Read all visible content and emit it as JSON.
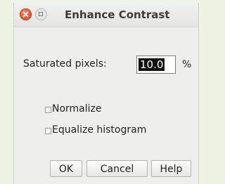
{
  "window": {
    "title": "Enhance Contrast"
  },
  "saturated": {
    "label": "Saturated pixels:",
    "value": "10.0",
    "unit": "%"
  },
  "options": [
    {
      "label": "Normalize",
      "checked": false
    },
    {
      "label": "Equalize histogram",
      "checked": false
    }
  ],
  "buttons": {
    "ok": "OK",
    "cancel": "Cancel",
    "help": "Help"
  },
  "icons": {
    "close": "close-icon",
    "maximize": "maximize-icon"
  },
  "colors": {
    "close_button": "#e2522a",
    "selection": "#111111"
  }
}
